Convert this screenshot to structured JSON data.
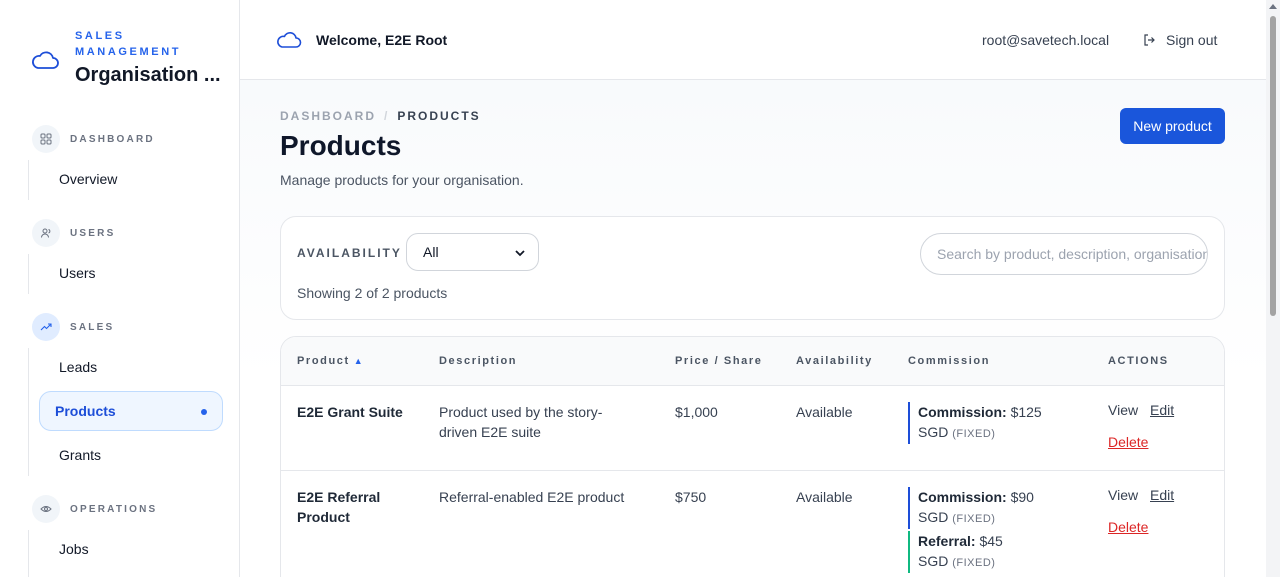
{
  "brand": {
    "subtitle": "SALES MANAGEMENT",
    "title": "Organisation ..."
  },
  "sidebar": {
    "sections": [
      {
        "label": "DASHBOARD",
        "items": [
          "Overview"
        ]
      },
      {
        "label": "USERS",
        "items": [
          "Users"
        ]
      },
      {
        "label": "SALES",
        "items": [
          "Leads",
          "Products",
          "Grants"
        ]
      },
      {
        "label": "OPERATIONS",
        "items": [
          "Jobs"
        ]
      }
    ],
    "active_item": "Products"
  },
  "header": {
    "welcome": "Welcome, E2E Root",
    "email": "root@savetech.local",
    "signout": "Sign out"
  },
  "breadcrumb": {
    "root": "DASHBOARD",
    "separator": "/",
    "current": "PRODUCTS"
  },
  "page": {
    "title": "Products",
    "subtitle": "Manage products for your organisation.",
    "new_button": "New product"
  },
  "filters": {
    "availability_label": "AVAILABILITY",
    "availability_value": "All",
    "search_placeholder": "Search by product, description, organisation",
    "showing": "Showing 2 of 2 products"
  },
  "table": {
    "headers": [
      "Product",
      "Description",
      "Price / Share",
      "Availability",
      "Commission",
      "ACTIONS"
    ],
    "sort_indicator": "▲",
    "rows": [
      {
        "product_line1": "E2E Grant Suite",
        "product_line2": "",
        "desc_line1": "Product used by the story-",
        "desc_line2": "driven E2E suite",
        "price": "$1,000",
        "availability": "Available",
        "commission_label": "Commission:",
        "commission_value": "$125",
        "commission_currency": "SGD",
        "commission_type": "(FIXED)",
        "view": "View",
        "edit": "Edit",
        "delete": "Delete"
      },
      {
        "product_line1": "E2E Referral",
        "product_line2": "Product",
        "desc_line1": "Referral-enabled E2E product",
        "desc_line2": "",
        "price": "$750",
        "availability": "Available",
        "commission_label": "Commission:",
        "commission_value": "$90",
        "commission_currency": "SGD",
        "commission_type": "(FIXED)",
        "referral_label": "Referral:",
        "referral_value": "$45",
        "referral_currency": "SGD",
        "referral_type": "(FIXED)",
        "view": "View",
        "edit": "Edit",
        "delete": "Delete"
      }
    ]
  },
  "colors": {
    "accent": "#1a56db",
    "danger": "#dc2626",
    "referral": "#10b981"
  }
}
